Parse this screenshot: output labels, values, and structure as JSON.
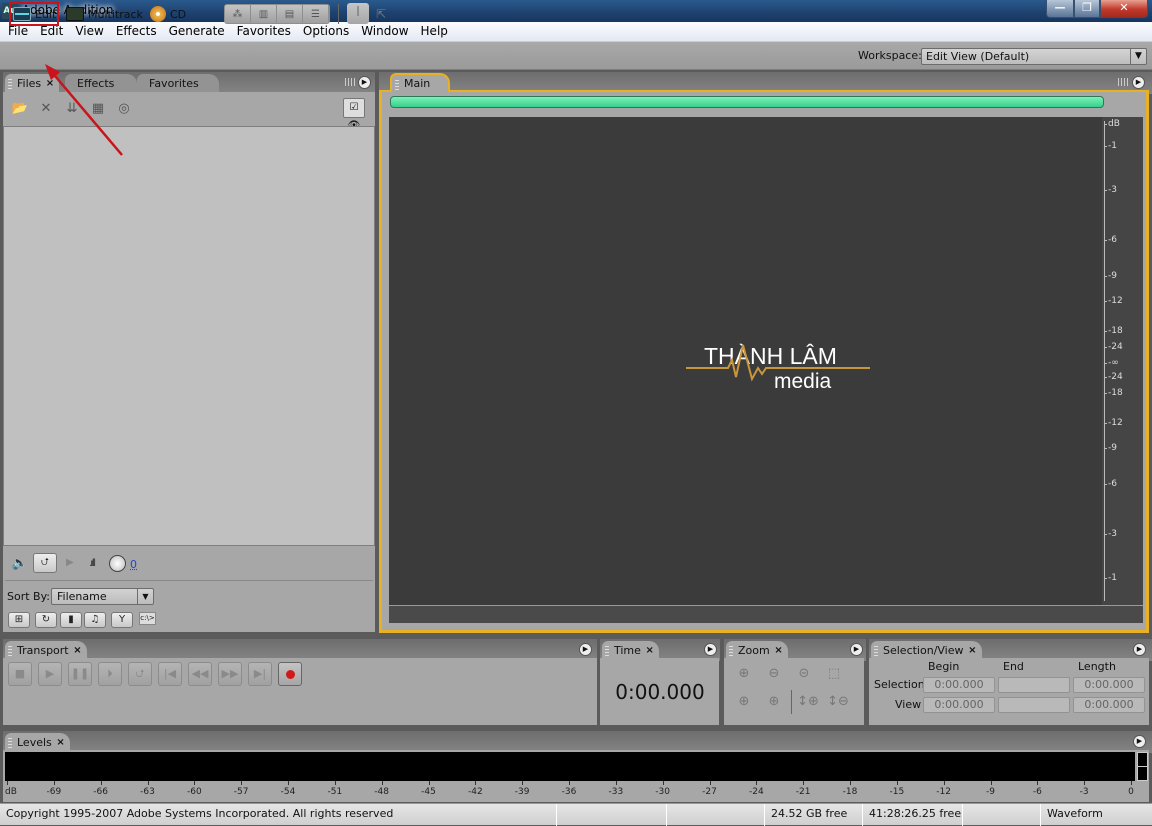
{
  "window": {
    "title": "Adobe Audition",
    "app_icon": "Au",
    "min": "—",
    "max": "❐",
    "close": "✕"
  },
  "menu": [
    "File",
    "Edit",
    "View",
    "Effects",
    "Generate",
    "Favorites",
    "Options",
    "Window",
    "Help"
  ],
  "toolbar": {
    "modes": [
      {
        "label": "Edit",
        "icon": "waveform-edit-icon",
        "highlighted": true
      },
      {
        "label": "Multitrack",
        "icon": "multitrack-icon"
      },
      {
        "label": "CD",
        "icon": "cd-icon"
      }
    ],
    "workspace_label": "Workspace:",
    "workspace_value": "Edit View (Default)",
    "annotation_color": "#c8141a"
  },
  "files_panel": {
    "tabs": [
      {
        "label": "Files",
        "active": true
      },
      {
        "label": "Effects"
      },
      {
        "label": "Favorites"
      }
    ],
    "volume_value": "0",
    "sort_label": "Sort By:",
    "sort_value": "Filename"
  },
  "main_panel": {
    "tab": "Main",
    "accent_color": "#e8b123",
    "overview_color": "#4ee29f",
    "db_labels": [
      "dB",
      "-1",
      "-3",
      "-6",
      "-9",
      "-12",
      "-18",
      "-24",
      "-∞",
      "-24",
      "-18",
      "-12",
      "-9",
      "-6",
      "-3",
      "-1"
    ],
    "logo": {
      "line1": "THÀNH LÂM",
      "line2": "media",
      "accent": "#c8963c"
    }
  },
  "transport": {
    "tab": "Transport",
    "buttons": [
      "■",
      "▶",
      "❚❚",
      "⏵",
      "⮍",
      "|◀",
      "◀◀",
      "▶▶",
      "▶|",
      "●"
    ]
  },
  "time": {
    "tab": "Time",
    "value": "0:00.000"
  },
  "zoom": {
    "tab": "Zoom"
  },
  "selection_view": {
    "tab": "Selection/View",
    "columns": [
      "Begin",
      "End",
      "Length"
    ],
    "rows": [
      {
        "label": "Selection",
        "begin": "0:00.000",
        "end": "",
        "length": "0:00.000"
      },
      {
        "label": "View",
        "begin": "0:00.000",
        "end": "",
        "length": "0:00.000"
      }
    ]
  },
  "levels": {
    "tab": "Levels",
    "scale": [
      "dB",
      "-69",
      "-66",
      "-63",
      "-60",
      "-57",
      "-54",
      "-51",
      "-48",
      "-45",
      "-42",
      "-39",
      "-36",
      "-33",
      "-30",
      "-27",
      "-24",
      "-21",
      "-18",
      "-15",
      "-12",
      "-9",
      "-6",
      "-3",
      "0"
    ]
  },
  "status": {
    "copyright": "Copyright 1995-2007 Adobe Systems Incorporated. All rights reserved",
    "disk_free": "24.52 GB free",
    "time_free": "41:28:26.25 free",
    "view": "Waveform"
  }
}
